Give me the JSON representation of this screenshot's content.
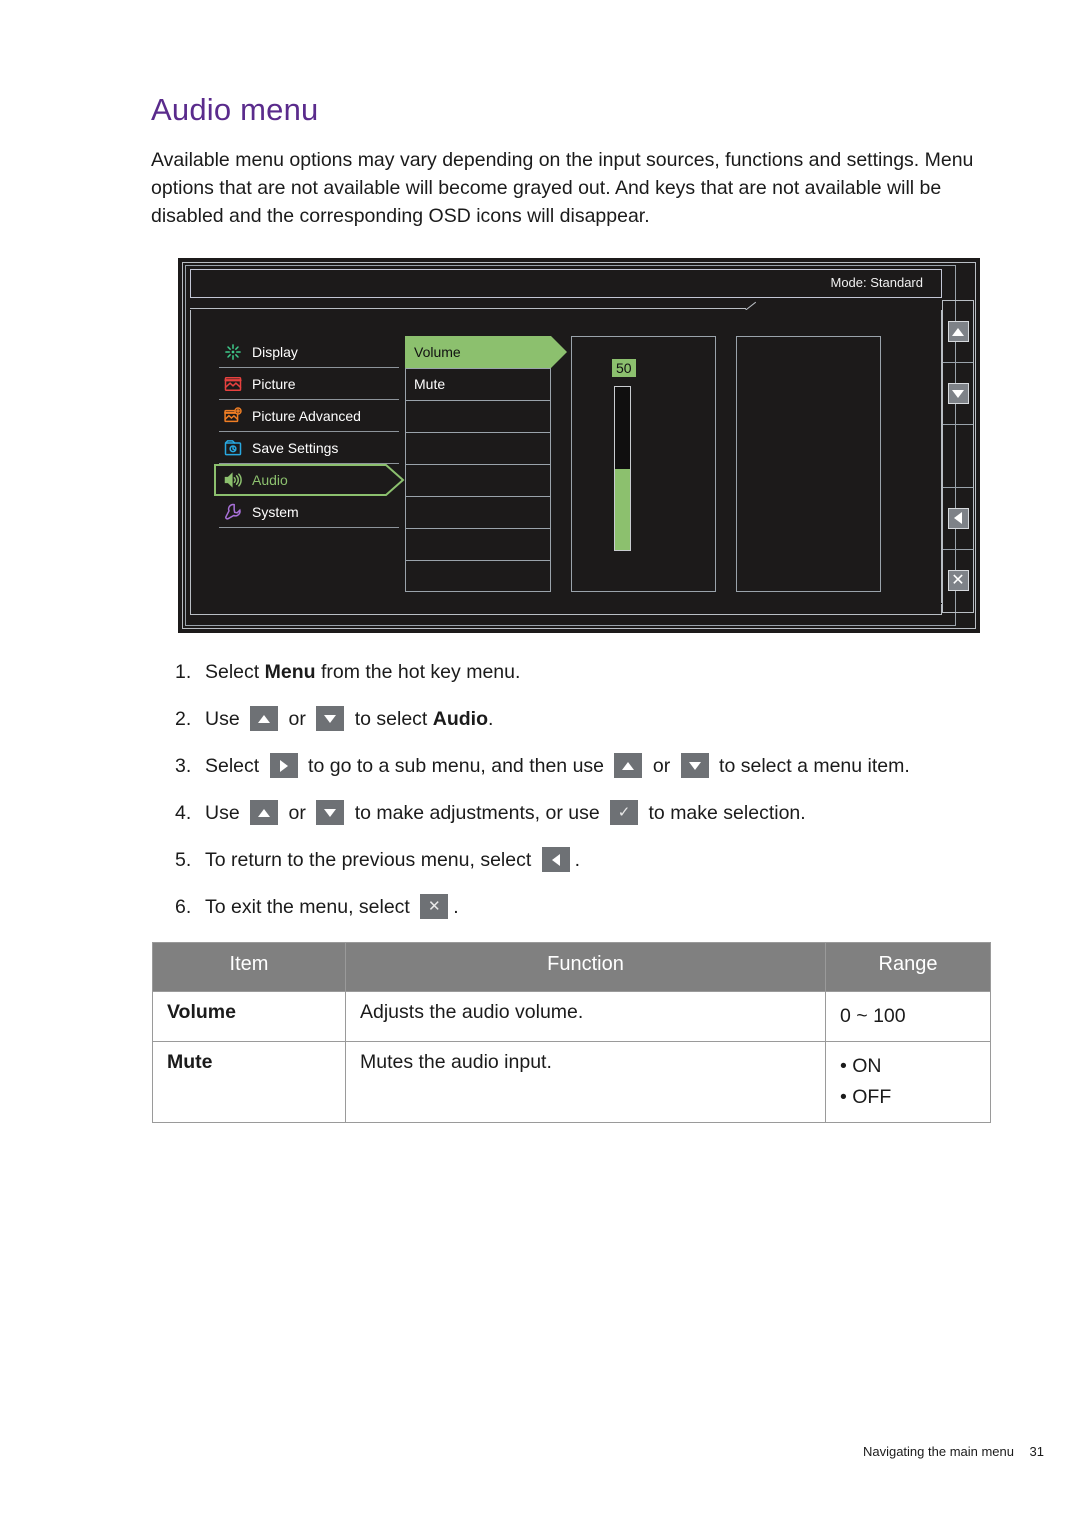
{
  "page": {
    "title": "Audio menu",
    "intro": "Available menu options may vary depending on the input sources, functions and settings. Menu options that are not available will become grayed out. And keys that are not available will be disabled and the corresponding OSD icons will disappear.",
    "accent_color": "#5a2b8c"
  },
  "osd": {
    "mode_text": "Mode: Standard",
    "highlight_color": "#8cc06e",
    "background_color": "#1c1a1a",
    "categories": [
      {
        "label": "Display",
        "icon": "display-icon",
        "icon_color": "#3ec98a",
        "selected": false
      },
      {
        "label": "Picture",
        "icon": "picture-icon",
        "icon_color": "#e8413f",
        "selected": false
      },
      {
        "label": "Picture Advanced",
        "icon": "picture-advanced-icon",
        "icon_color": "#ef7e24",
        "selected": false
      },
      {
        "label": "Save Settings",
        "icon": "save-settings-icon",
        "icon_color": "#28a8e0",
        "selected": false
      },
      {
        "label": "Audio",
        "icon": "audio-icon",
        "icon_color": "#8cc06e",
        "selected": true
      },
      {
        "label": "System",
        "icon": "system-icon",
        "icon_color": "#a870d8",
        "selected": false
      }
    ],
    "submenu": [
      {
        "label": "Volume",
        "active": true
      },
      {
        "label": "Mute",
        "active": false
      },
      {
        "label": "",
        "active": false
      },
      {
        "label": "",
        "active": false
      },
      {
        "label": "",
        "active": false
      },
      {
        "label": "",
        "active": false
      },
      {
        "label": "",
        "active": false
      },
      {
        "label": "",
        "active": false
      }
    ],
    "volume": {
      "value": "50",
      "fill_percent": 50
    },
    "keys": [
      {
        "icon": "arrow-up-icon",
        "name": "osd-key-up"
      },
      {
        "icon": "arrow-down-icon",
        "name": "osd-key-down"
      },
      {
        "icon": "",
        "name": "osd-key-blank"
      },
      {
        "icon": "arrow-left-icon",
        "name": "osd-key-back"
      },
      {
        "icon": "close-x-icon",
        "name": "osd-key-exit"
      }
    ]
  },
  "steps": [
    {
      "num": "1.",
      "parts": [
        {
          "t": "text",
          "v": "Select "
        },
        {
          "t": "bold",
          "v": "Menu"
        },
        {
          "t": "text",
          "v": " from the hot key menu."
        }
      ]
    },
    {
      "num": "2.",
      "parts": [
        {
          "t": "text",
          "v": "Use "
        },
        {
          "t": "key",
          "v": "arrow-up-icon"
        },
        {
          "t": "text",
          "v": " or "
        },
        {
          "t": "key",
          "v": "arrow-down-icon"
        },
        {
          "t": "text",
          "v": " to select "
        },
        {
          "t": "bold",
          "v": "Audio"
        },
        {
          "t": "text",
          "v": "."
        }
      ]
    },
    {
      "num": "3.",
      "parts": [
        {
          "t": "text",
          "v": "Select "
        },
        {
          "t": "key",
          "v": "arrow-right-icon"
        },
        {
          "t": "text",
          "v": " to go to a sub menu, and then use "
        },
        {
          "t": "key",
          "v": "arrow-up-icon"
        },
        {
          "t": "text",
          "v": " or "
        },
        {
          "t": "key",
          "v": "arrow-down-icon"
        },
        {
          "t": "text",
          "v": " to select a menu item."
        }
      ]
    },
    {
      "num": "4.",
      "parts": [
        {
          "t": "text",
          "v": "Use "
        },
        {
          "t": "key",
          "v": "arrow-up-icon"
        },
        {
          "t": "text",
          "v": " or "
        },
        {
          "t": "key",
          "v": "arrow-down-icon"
        },
        {
          "t": "text",
          "v": " to make adjustments, or use "
        },
        {
          "t": "key",
          "v": "check-icon"
        },
        {
          "t": "text",
          "v": " to make selection."
        }
      ]
    },
    {
      "num": "5.",
      "parts": [
        {
          "t": "text",
          "v": "To return to the previous menu, select "
        },
        {
          "t": "key",
          "v": "arrow-left-icon"
        },
        {
          "t": "text",
          "v": "."
        }
      ]
    },
    {
      "num": "6.",
      "parts": [
        {
          "t": "text",
          "v": "To exit the menu, select "
        },
        {
          "t": "key",
          "v": "close-x-icon"
        },
        {
          "t": "text",
          "v": "."
        }
      ]
    }
  ],
  "table": {
    "headers": [
      "Item",
      "Function",
      "Range"
    ],
    "rows": [
      {
        "item": "Volume",
        "function": "Adjusts the audio volume.",
        "range": [
          "0 ~ 100"
        ]
      },
      {
        "item": "Mute",
        "function": "Mutes the audio input.",
        "range": [
          "• ON",
          "• OFF"
        ]
      }
    ]
  },
  "footer": {
    "label": "Navigating the main menu",
    "page": "31"
  }
}
